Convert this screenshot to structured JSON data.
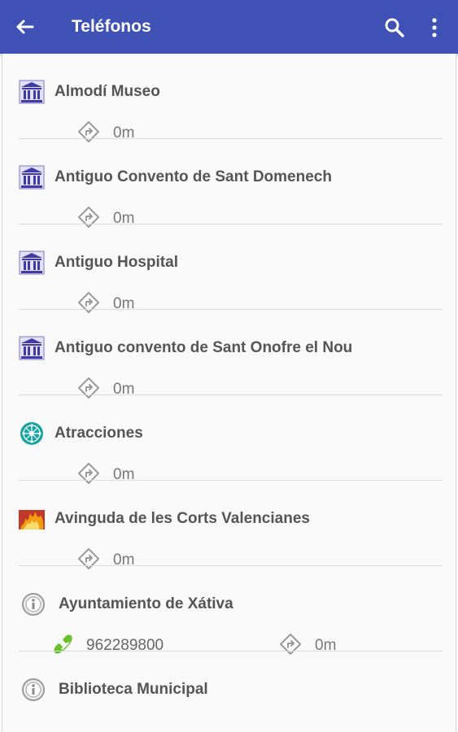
{
  "appbar": {
    "title": "Teléfonos",
    "back_icon": "arrow-left-icon",
    "search_icon": "search-icon",
    "menu_icon": "more-vert-icon",
    "color": "#3f51b5"
  },
  "items": [
    {
      "name": "Almodí Museo",
      "icon": "museum-icon",
      "distance": "0m"
    },
    {
      "name": "Antiguo Convento de Sant Domenech",
      "icon": "museum-icon",
      "distance": "0m"
    },
    {
      "name": "Antiguo Hospital",
      "icon": "museum-icon",
      "distance": "0m"
    },
    {
      "name": "Antiguo convento de Sant Onofre el Nou",
      "icon": "museum-icon",
      "distance": "0m"
    },
    {
      "name": "Atracciones",
      "icon": "attraction-icon",
      "distance": "0m"
    },
    {
      "name": "Avinguda de les Corts Valencianes",
      "icon": "fire-icon",
      "distance": "0m"
    },
    {
      "name": "Ayuntamiento de Xátiva",
      "icon": "info-icon",
      "phone": "962289800",
      "distance": "0m"
    },
    {
      "name": "Biblioteca Municipal",
      "icon": "info-icon"
    }
  ]
}
